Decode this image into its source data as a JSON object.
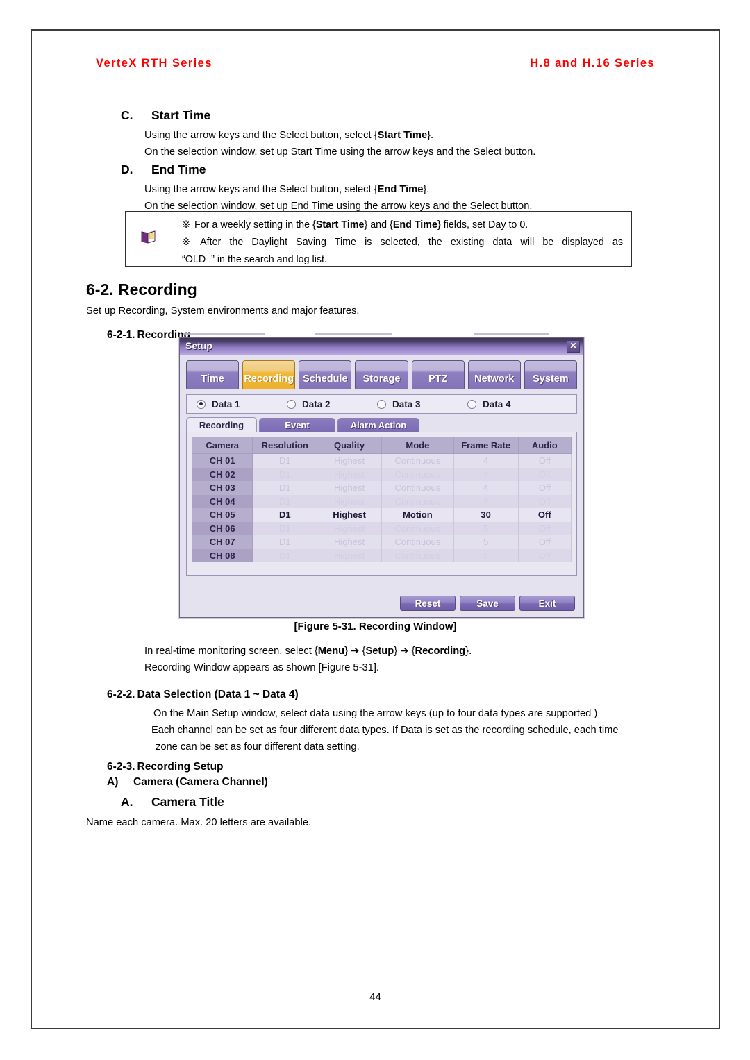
{
  "header": {
    "left": "VerteX RTH Series",
    "right": "H.8 and H.16 Series",
    "color": "#ff0000"
  },
  "sections": {
    "c": {
      "letter": "C.",
      "title": "Start Time",
      "line1_pre": "Using the arrow keys and the Select button, select {",
      "line1_bold": "Start Time",
      "line1_post": "}.",
      "line2": "On the selection window, set up Start Time using the arrow keys and the Select button."
    },
    "d": {
      "letter": "D.",
      "title": "End Time",
      "line1_pre": "Using the arrow keys and the Select button, select {",
      "line1_bold": "End Time",
      "line1_post": "}.",
      "line2": "On the selection window, set up End Time using the arrow keys and the Select button."
    }
  },
  "note_box": {
    "icon": "book-icon",
    "mark": "※",
    "line1_a": "For a weekly setting in the {",
    "line1_b": "Start Time",
    "line1_c": "} and {",
    "line1_d": "End Time",
    "line1_e": "} fields, set Day to 0.",
    "line2": "After the Daylight Saving Time is selected, the existing data will be displayed as",
    "line3": "“OLD_” in the search and log list."
  },
  "recording_section": {
    "heading": "6-2. Recording",
    "intro": "Set up Recording, System environments and major features.",
    "sub1_num": "6-2-1.",
    "sub1_title": "Recording"
  },
  "setup_window": {
    "title": "Setup",
    "close_label": "✕",
    "main_tabs": [
      {
        "label": "Time",
        "active": false
      },
      {
        "label": "Recording",
        "active": true
      },
      {
        "label": "Schedule",
        "active": false
      },
      {
        "label": "Storage",
        "active": false
      },
      {
        "label": "PTZ",
        "active": false
      },
      {
        "label": "Network",
        "active": false
      },
      {
        "label": "System",
        "active": false
      }
    ],
    "data_radios": [
      {
        "label": "Data 1",
        "checked": true
      },
      {
        "label": "Data 2",
        "checked": false
      },
      {
        "label": "Data 3",
        "checked": false
      },
      {
        "label": "Data 4",
        "checked": false
      }
    ],
    "sub_tabs": [
      {
        "label": "Recording",
        "active": true
      },
      {
        "label": "Event",
        "active": false
      },
      {
        "label": "Alarm Action",
        "active": false
      }
    ],
    "table": {
      "columns": [
        "Camera",
        "Resolution",
        "Quality",
        "Mode",
        "Frame Rate",
        "Audio"
      ],
      "rows": [
        {
          "camera": "CH 01",
          "resolution": "D1",
          "quality": "Highest",
          "mode": "Continuous",
          "frame_rate": "4",
          "audio": "Off",
          "selected": false
        },
        {
          "camera": "CH 02",
          "resolution": "D1",
          "quality": "Highest",
          "mode": "Continuous",
          "frame_rate": "4",
          "audio": "Off",
          "selected": false
        },
        {
          "camera": "CH 03",
          "resolution": "D1",
          "quality": "Highest",
          "mode": "Continuous",
          "frame_rate": "4",
          "audio": "Off",
          "selected": false
        },
        {
          "camera": "CH 04",
          "resolution": "D1",
          "quality": "Highest",
          "mode": "Continuous",
          "frame_rate": "4",
          "audio": "Off",
          "selected": false
        },
        {
          "camera": "CH 05",
          "resolution": "D1",
          "quality": "Highest",
          "mode": "Motion",
          "frame_rate": "30",
          "audio": "Off",
          "selected": true
        },
        {
          "camera": "CH 06",
          "resolution": "D1",
          "quality": "Highest",
          "mode": "Continuous",
          "frame_rate": "5",
          "audio": "Off",
          "selected": false
        },
        {
          "camera": "CH 07",
          "resolution": "D1",
          "quality": "Highest",
          "mode": "Continuous",
          "frame_rate": "5",
          "audio": "Off",
          "selected": false
        },
        {
          "camera": "CH 08",
          "resolution": "D1",
          "quality": "Highest",
          "mode": "Continuous",
          "frame_rate": "5",
          "audio": "Off",
          "selected": false
        }
      ]
    },
    "buttons": [
      {
        "label": "Reset"
      },
      {
        "label": "Save"
      },
      {
        "label": "Exit"
      }
    ]
  },
  "figure_caption": "[Figure 5-31. Recording Window]",
  "after_figure": {
    "line1_a": "In real-time monitoring screen, select {",
    "line1_b": "Menu",
    "line1_c": "} ➔ {",
    "line1_d": "Setup",
    "line1_e": "} ➔ {",
    "line1_f": "Recording",
    "line1_g": "}.",
    "line2": "Recording Window appears as shown [Figure 5-31]."
  },
  "sub2": {
    "num": "6-2-2.",
    "title": "Data Selection (Data 1 ~ Data 4)",
    "line1": "On the Main Setup window, select data using the arrow keys (up to four data types are supported )",
    "line2": "Each channel can be set as four different data types. If Data is set as the recording schedule, each time",
    "line3": "zone can be set as four different data setting."
  },
  "sub3": {
    "num": "6-2-3.",
    "title": "Recording Setup",
    "item_a_letter": "A)",
    "item_a_title": "Camera (Camera Channel)"
  },
  "camera_title": {
    "letter": "A.",
    "title": "Camera Title",
    "body": "Name each camera. Max. 20 letters are available."
  },
  "page_number": "44"
}
